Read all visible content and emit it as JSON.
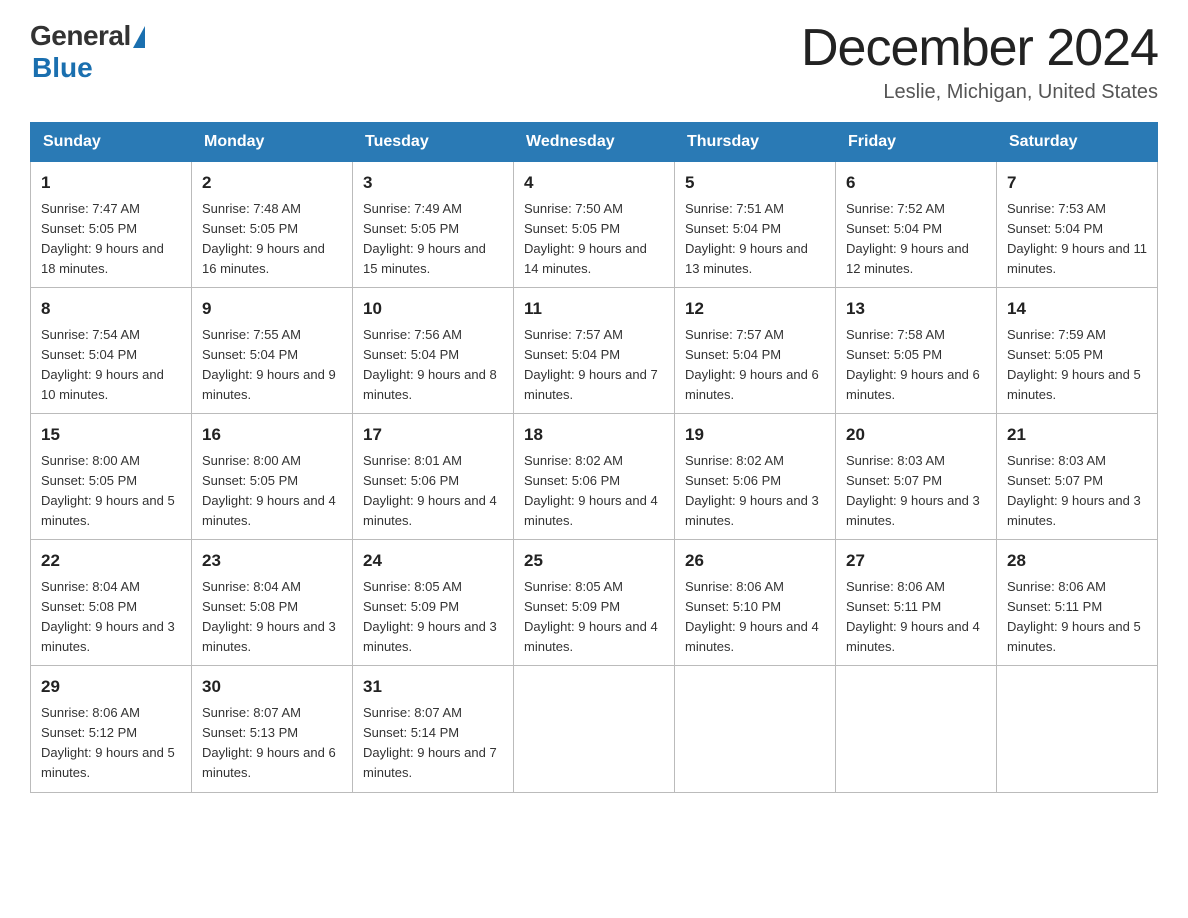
{
  "header": {
    "logo_general": "General",
    "logo_blue": "Blue",
    "month_title": "December 2024",
    "location": "Leslie, Michigan, United States"
  },
  "days_of_week": [
    "Sunday",
    "Monday",
    "Tuesday",
    "Wednesday",
    "Thursday",
    "Friday",
    "Saturday"
  ],
  "weeks": [
    [
      {
        "day": "1",
        "sunrise": "7:47 AM",
        "sunset": "5:05 PM",
        "daylight": "9 hours and 18 minutes."
      },
      {
        "day": "2",
        "sunrise": "7:48 AM",
        "sunset": "5:05 PM",
        "daylight": "9 hours and 16 minutes."
      },
      {
        "day": "3",
        "sunrise": "7:49 AM",
        "sunset": "5:05 PM",
        "daylight": "9 hours and 15 minutes."
      },
      {
        "day": "4",
        "sunrise": "7:50 AM",
        "sunset": "5:05 PM",
        "daylight": "9 hours and 14 minutes."
      },
      {
        "day": "5",
        "sunrise": "7:51 AM",
        "sunset": "5:04 PM",
        "daylight": "9 hours and 13 minutes."
      },
      {
        "day": "6",
        "sunrise": "7:52 AM",
        "sunset": "5:04 PM",
        "daylight": "9 hours and 12 minutes."
      },
      {
        "day": "7",
        "sunrise": "7:53 AM",
        "sunset": "5:04 PM",
        "daylight": "9 hours and 11 minutes."
      }
    ],
    [
      {
        "day": "8",
        "sunrise": "7:54 AM",
        "sunset": "5:04 PM",
        "daylight": "9 hours and 10 minutes."
      },
      {
        "day": "9",
        "sunrise": "7:55 AM",
        "sunset": "5:04 PM",
        "daylight": "9 hours and 9 minutes."
      },
      {
        "day": "10",
        "sunrise": "7:56 AM",
        "sunset": "5:04 PM",
        "daylight": "9 hours and 8 minutes."
      },
      {
        "day": "11",
        "sunrise": "7:57 AM",
        "sunset": "5:04 PM",
        "daylight": "9 hours and 7 minutes."
      },
      {
        "day": "12",
        "sunrise": "7:57 AM",
        "sunset": "5:04 PM",
        "daylight": "9 hours and 6 minutes."
      },
      {
        "day": "13",
        "sunrise": "7:58 AM",
        "sunset": "5:05 PM",
        "daylight": "9 hours and 6 minutes."
      },
      {
        "day": "14",
        "sunrise": "7:59 AM",
        "sunset": "5:05 PM",
        "daylight": "9 hours and 5 minutes."
      }
    ],
    [
      {
        "day": "15",
        "sunrise": "8:00 AM",
        "sunset": "5:05 PM",
        "daylight": "9 hours and 5 minutes."
      },
      {
        "day": "16",
        "sunrise": "8:00 AM",
        "sunset": "5:05 PM",
        "daylight": "9 hours and 4 minutes."
      },
      {
        "day": "17",
        "sunrise": "8:01 AM",
        "sunset": "5:06 PM",
        "daylight": "9 hours and 4 minutes."
      },
      {
        "day": "18",
        "sunrise": "8:02 AM",
        "sunset": "5:06 PM",
        "daylight": "9 hours and 4 minutes."
      },
      {
        "day": "19",
        "sunrise": "8:02 AM",
        "sunset": "5:06 PM",
        "daylight": "9 hours and 3 minutes."
      },
      {
        "day": "20",
        "sunrise": "8:03 AM",
        "sunset": "5:07 PM",
        "daylight": "9 hours and 3 minutes."
      },
      {
        "day": "21",
        "sunrise": "8:03 AM",
        "sunset": "5:07 PM",
        "daylight": "9 hours and 3 minutes."
      }
    ],
    [
      {
        "day": "22",
        "sunrise": "8:04 AM",
        "sunset": "5:08 PM",
        "daylight": "9 hours and 3 minutes."
      },
      {
        "day": "23",
        "sunrise": "8:04 AM",
        "sunset": "5:08 PM",
        "daylight": "9 hours and 3 minutes."
      },
      {
        "day": "24",
        "sunrise": "8:05 AM",
        "sunset": "5:09 PM",
        "daylight": "9 hours and 3 minutes."
      },
      {
        "day": "25",
        "sunrise": "8:05 AM",
        "sunset": "5:09 PM",
        "daylight": "9 hours and 4 minutes."
      },
      {
        "day": "26",
        "sunrise": "8:06 AM",
        "sunset": "5:10 PM",
        "daylight": "9 hours and 4 minutes."
      },
      {
        "day": "27",
        "sunrise": "8:06 AM",
        "sunset": "5:11 PM",
        "daylight": "9 hours and 4 minutes."
      },
      {
        "day": "28",
        "sunrise": "8:06 AM",
        "sunset": "5:11 PM",
        "daylight": "9 hours and 5 minutes."
      }
    ],
    [
      {
        "day": "29",
        "sunrise": "8:06 AM",
        "sunset": "5:12 PM",
        "daylight": "9 hours and 5 minutes."
      },
      {
        "day": "30",
        "sunrise": "8:07 AM",
        "sunset": "5:13 PM",
        "daylight": "9 hours and 6 minutes."
      },
      {
        "day": "31",
        "sunrise": "8:07 AM",
        "sunset": "5:14 PM",
        "daylight": "9 hours and 7 minutes."
      },
      null,
      null,
      null,
      null
    ]
  ]
}
